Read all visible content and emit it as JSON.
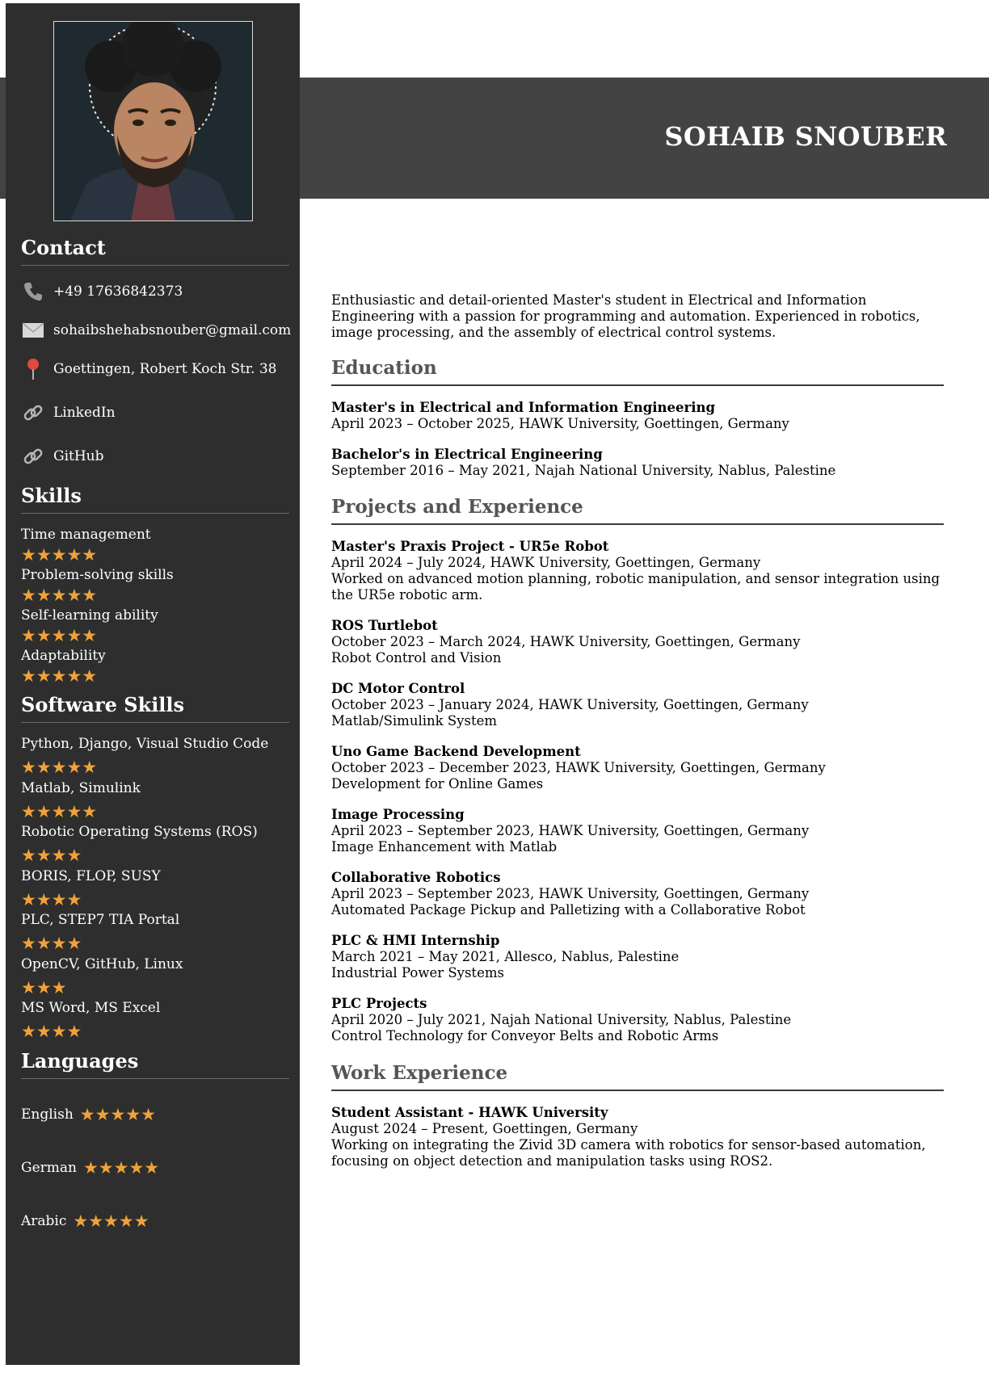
{
  "header": {
    "name": "SOHAIB SNOUBER"
  },
  "sidebar": {
    "contact_title": "Contact",
    "contact": [
      {
        "icon": "phone-icon",
        "text": "+49 17636842373"
      },
      {
        "icon": "envelope-icon",
        "text": "sohaibshehabsnouber@gmail.com"
      },
      {
        "icon": "pin-icon",
        "text": "Goettingen, Robert Koch Str. 38"
      },
      {
        "icon": "link-icon",
        "text": "LinkedIn"
      },
      {
        "icon": "link-icon",
        "text": "GitHub"
      }
    ],
    "skills_title": "Skills",
    "skills": [
      {
        "name": "Time management",
        "rating": 5,
        "stars": "★★★★★"
      },
      {
        "name": "Problem-solving skills",
        "rating": 5,
        "stars": "★★★★★"
      },
      {
        "name": "Self-learning ability",
        "rating": 5,
        "stars": "★★★★★"
      },
      {
        "name": "Adaptability",
        "rating": 5,
        "stars": "★★★★★"
      }
    ],
    "software_title": "Software Skills",
    "software": [
      {
        "name": "Python, Django, Visual Studio Code",
        "rating": 5,
        "stars": "★★★★★"
      },
      {
        "name": "Matlab, Simulink",
        "rating": 5,
        "stars": "★★★★★"
      },
      {
        "name": "Robotic Operating Systems (ROS)",
        "rating": 4,
        "stars": "★★★★"
      },
      {
        "name": "BORIS, FLOP, SUSY",
        "rating": 4,
        "stars": "★★★★"
      },
      {
        "name": "PLC, STEP7 TIA Portal",
        "rating": 4,
        "stars": "★★★★"
      },
      {
        "name": "OpenCV, GitHub, Linux",
        "rating": 3,
        "stars": "★★★"
      },
      {
        "name": "MS Word, MS Excel",
        "rating": 4,
        "stars": "★★★★"
      }
    ],
    "languages_title": "Languages",
    "languages": [
      {
        "name": "English",
        "rating": 5,
        "stars": "★★★★★"
      },
      {
        "name": "German",
        "rating": 5,
        "stars": "★★★★★"
      },
      {
        "name": "Arabic",
        "rating": 5,
        "stars": "★★★★★"
      }
    ]
  },
  "main": {
    "summary": "Enthusiastic and detail-oriented Master's student in Electrical and Information Engineering with a passion for programming and automation. Experienced in robotics, image processing, and the assembly of electrical control systems.",
    "education_title": "Education",
    "education": [
      {
        "title": "Master's in Electrical and Information Engineering",
        "meta": "April 2023 – October 2025, HAWK University, Goettingen, Germany"
      },
      {
        "title": "Bachelor's in Electrical Engineering",
        "meta": "September 2016 – May 2021, Najah National University, Nablus, Palestine"
      }
    ],
    "projects_title": "Projects and Experience",
    "projects": [
      {
        "title": "Master's Praxis Project - UR5e Robot",
        "meta": "April 2024 – July 2024, HAWK University, Goettingen, Germany",
        "desc": "Worked on advanced motion planning, robotic manipulation, and sensor integration using the UR5e robotic arm."
      },
      {
        "title": "ROS Turtlebot",
        "meta": "October 2023 – March 2024, HAWK University, Goettingen, Germany",
        "desc": "Robot Control and Vision"
      },
      {
        "title": "DC Motor Control",
        "meta": "October 2023 – January 2024, HAWK University, Goettingen, Germany",
        "desc": "Matlab/Simulink System"
      },
      {
        "title": "Uno Game Backend Development",
        "meta": "October 2023 – December 2023, HAWK University, Goettingen, Germany",
        "desc": "Development for Online Games"
      },
      {
        "title": "Image Processing",
        "meta": "April 2023 – September 2023, HAWK University, Goettingen, Germany",
        "desc": "Image Enhancement with Matlab"
      },
      {
        "title": "Collaborative Robotics",
        "meta": "April 2023 – September 2023, HAWK University, Goettingen, Germany",
        "desc": "Automated Package Pickup and Palletizing with a Collaborative Robot"
      },
      {
        "title": "PLC & HMI Internship",
        "meta": "March 2021 – May 2021, Allesco, Nablus, Palestine",
        "desc": "Industrial Power Systems"
      },
      {
        "title": "PLC Projects",
        "meta": "April 2020 – July 2021, Najah National University, Nablus, Palestine",
        "desc": "Control Technology for Conveyor Belts and Robotic Arms"
      }
    ],
    "work_title": "Work Experience",
    "work": [
      {
        "title": "Student Assistant - HAWK University",
        "meta": "August 2024 – Present, Goettingen, Germany",
        "desc": "Working on integrating the Zivid 3D camera with robotics for sensor-based automation, focusing on object detection and manipulation tasks using ROS2."
      }
    ]
  },
  "colors": {
    "sidebar": "#2e2e2e",
    "band": "#434343",
    "star": "#f0a23a",
    "section_title": "#555555"
  }
}
